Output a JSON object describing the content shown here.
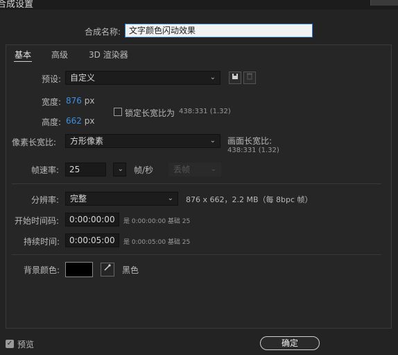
{
  "window": {
    "title": "合成设置"
  },
  "composition_name": {
    "label": "合成名称:",
    "value": "文字颜色闪动效果"
  },
  "tabs": [
    {
      "label": "基本"
    },
    {
      "label": "高级"
    },
    {
      "label": "3D 渲染器"
    }
  ],
  "preset": {
    "label": "预设:",
    "value": "自定义"
  },
  "width": {
    "label": "宽度:",
    "value": "876",
    "unit": "px"
  },
  "height": {
    "label": "高度:",
    "value": "662",
    "unit": "px"
  },
  "lock_aspect": {
    "label": "锁定长宽比为",
    "ratio": "438:331 (1.32)",
    "checked": false
  },
  "pixel_aspect": {
    "label": "像素长宽比:",
    "value": "方形像素"
  },
  "frame_aspect": {
    "label": "画面长宽比:",
    "value": "438:331 (1.32)"
  },
  "frame_rate": {
    "label": "帧速率:",
    "value": "25",
    "unit": "帧/秒",
    "drop_frame": "丢帧"
  },
  "resolution": {
    "label": "分辨率:",
    "value": "完整",
    "info": "876 x 662，2.2 MB（每 8bpc 帧）"
  },
  "start_timecode": {
    "label": "开始时间码:",
    "value": "0:00:00:00",
    "note": "是 0:00:00:00 基础 25"
  },
  "duration": {
    "label": "持续时间:",
    "value": "0:00:05:00",
    "note": "是 0:00:05:00 基础 25"
  },
  "background": {
    "label": "背景颜色:",
    "color": "#000000",
    "name": "黑色"
  },
  "preview": {
    "label": "预览",
    "checked": true
  },
  "ok_button": {
    "label": "确定"
  },
  "icons": {
    "save_preset": "save-icon",
    "delete_preset": "trash-icon",
    "eyedropper": "eyedropper-icon"
  }
}
